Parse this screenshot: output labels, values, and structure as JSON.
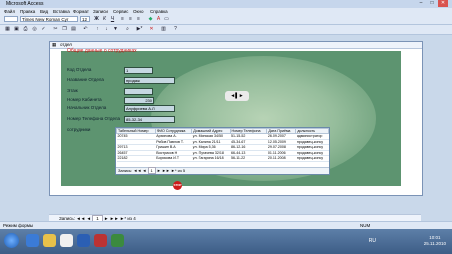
{
  "app": {
    "title": "Microsoft Access",
    "controls": {
      "min": "–",
      "max": "□",
      "close": "✕"
    }
  },
  "menu": [
    "Файл",
    "Правка",
    "Вид",
    "Вставка",
    "Формат",
    "Записи",
    "Сервис",
    "Окно",
    "Справка"
  ],
  "toolbar": {
    "font": "Times New Roman Cyr",
    "size": "12",
    "bold": "Ж",
    "italic": "К",
    "underline": "Ч"
  },
  "form": {
    "title": "отдел",
    "header": "Общие данные о сотрудниках",
    "fields": [
      {
        "label": "Код Отдела",
        "value": "1"
      },
      {
        "label": "Название Отдела",
        "value": "продаж"
      },
      {
        "label": "Этаж",
        "value": ""
      },
      {
        "label": "Номер Кабинета",
        "value": "230"
      },
      {
        "label": "Начальник Отдела",
        "value": "Ануфриева А.Л"
      },
      {
        "label": "Номер Телефона Отдела",
        "value": "85-32-34"
      }
    ],
    "staff_label": "сотрудники",
    "subform": {
      "columns": [
        "Табельный Номер",
        "ФИО Сотрудника",
        "Домашний Адрес",
        "Номер Телефона",
        "Дата Приёма",
        "должность"
      ],
      "rows": [
        [
          "20745",
          "Архипова А.",
          "ул. Минская 34/50",
          "51-15-52",
          "26.09.2007",
          "администратор"
        ],
        [
          "",
          "Рябов Павлов Т.",
          "ул. Калина 21/11",
          "45-34-67",
          "12.05.2009",
          "продавец-консу"
        ],
        [
          "29713",
          "Гришин В.А",
          "ул. Мира 5,36",
          "86-12-16",
          "29.07.2008",
          "продавец-консу"
        ],
        [
          "26457",
          "Востриков Н",
          "ул. Пугачева 32/18",
          "66-44-13",
          "01.11.2006",
          "продавец-консу"
        ],
        [
          "22182",
          "Борисова И.Т",
          "ул. Гагарина 16/18",
          "56-11-22",
          "20.11.2008",
          "продавец-консу"
        ]
      ],
      "nav": {
        "label": "Запись:",
        "current": "1",
        "total": "из 5"
      }
    },
    "nav_button": "◄▌►",
    "stop_label": "STOP"
  },
  "record_nav": {
    "label": "Запись:",
    "current": "1",
    "total": "из 4"
  },
  "status": {
    "mode": "Режим формы",
    "indicator": "NUM"
  },
  "taskbar": {
    "lang": "RU",
    "time": "10:01",
    "date": "25.11.2010"
  },
  "colors": {
    "form_bg": "#5d9470",
    "header_red": "#cc1111",
    "stop": "#cc1b1b"
  }
}
